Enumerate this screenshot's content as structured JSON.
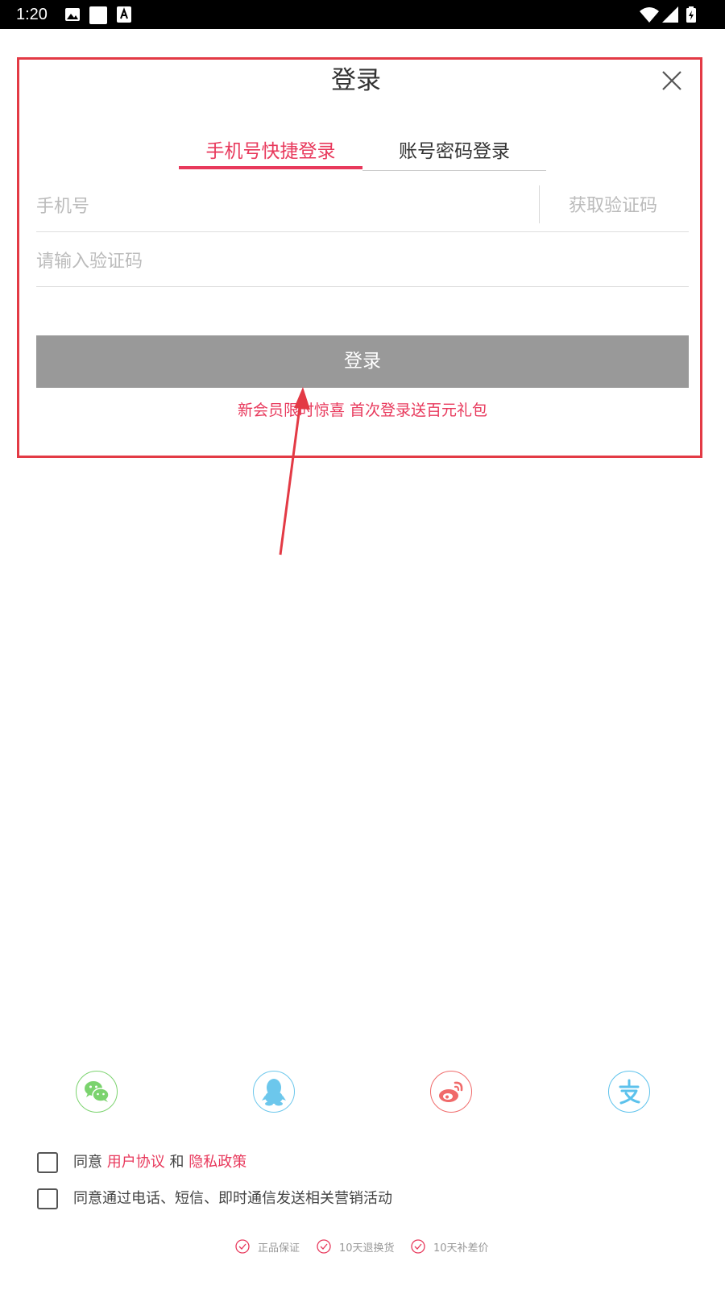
{
  "status_bar": {
    "time": "1:20",
    "left_icons": [
      "image-icon",
      "square-icon",
      "font-download-icon"
    ],
    "right_icons": [
      "wifi-icon",
      "cell-signal-icon",
      "battery-charging-icon"
    ]
  },
  "header": {
    "title": "登录",
    "close_icon": "close-icon"
  },
  "tabs": [
    {
      "label": "手机号快捷登录",
      "active": true
    },
    {
      "label": "账号密码登录",
      "active": false
    }
  ],
  "form": {
    "phone_placeholder": "手机号",
    "get_code_label": "获取验证码",
    "code_placeholder": "请输入验证码",
    "login_button_label": "登录",
    "promo_text": "新会员限时惊喜 首次登录送百元礼包"
  },
  "social_logins": [
    {
      "icon": "wechat-icon",
      "color": "#7bd36e"
    },
    {
      "icon": "qq-icon",
      "color": "#6cc7ec"
    },
    {
      "icon": "weibo-icon",
      "color": "#f06a6a"
    },
    {
      "icon": "alipay-icon",
      "color": "#5cc2ec"
    }
  ],
  "agreements": {
    "terms_prefix": "同意",
    "user_agreement_link": "用户协议",
    "and": "和",
    "privacy_policy_link": "隐私政策",
    "marketing_consent": "同意通过电话、短信、即时通信发送相关营销活动",
    "terms_checked": false,
    "marketing_checked": false
  },
  "guarantees": [
    {
      "icon": "check-circle-icon",
      "label": "正品保证"
    },
    {
      "icon": "check-circle-icon",
      "label": "10天退换货"
    },
    {
      "icon": "check-circle-icon",
      "label": "10天补差价"
    }
  ],
  "colors": {
    "accent": "#e8395c",
    "login_button_bg": "#999999",
    "annotation_red": "#e33a45"
  }
}
